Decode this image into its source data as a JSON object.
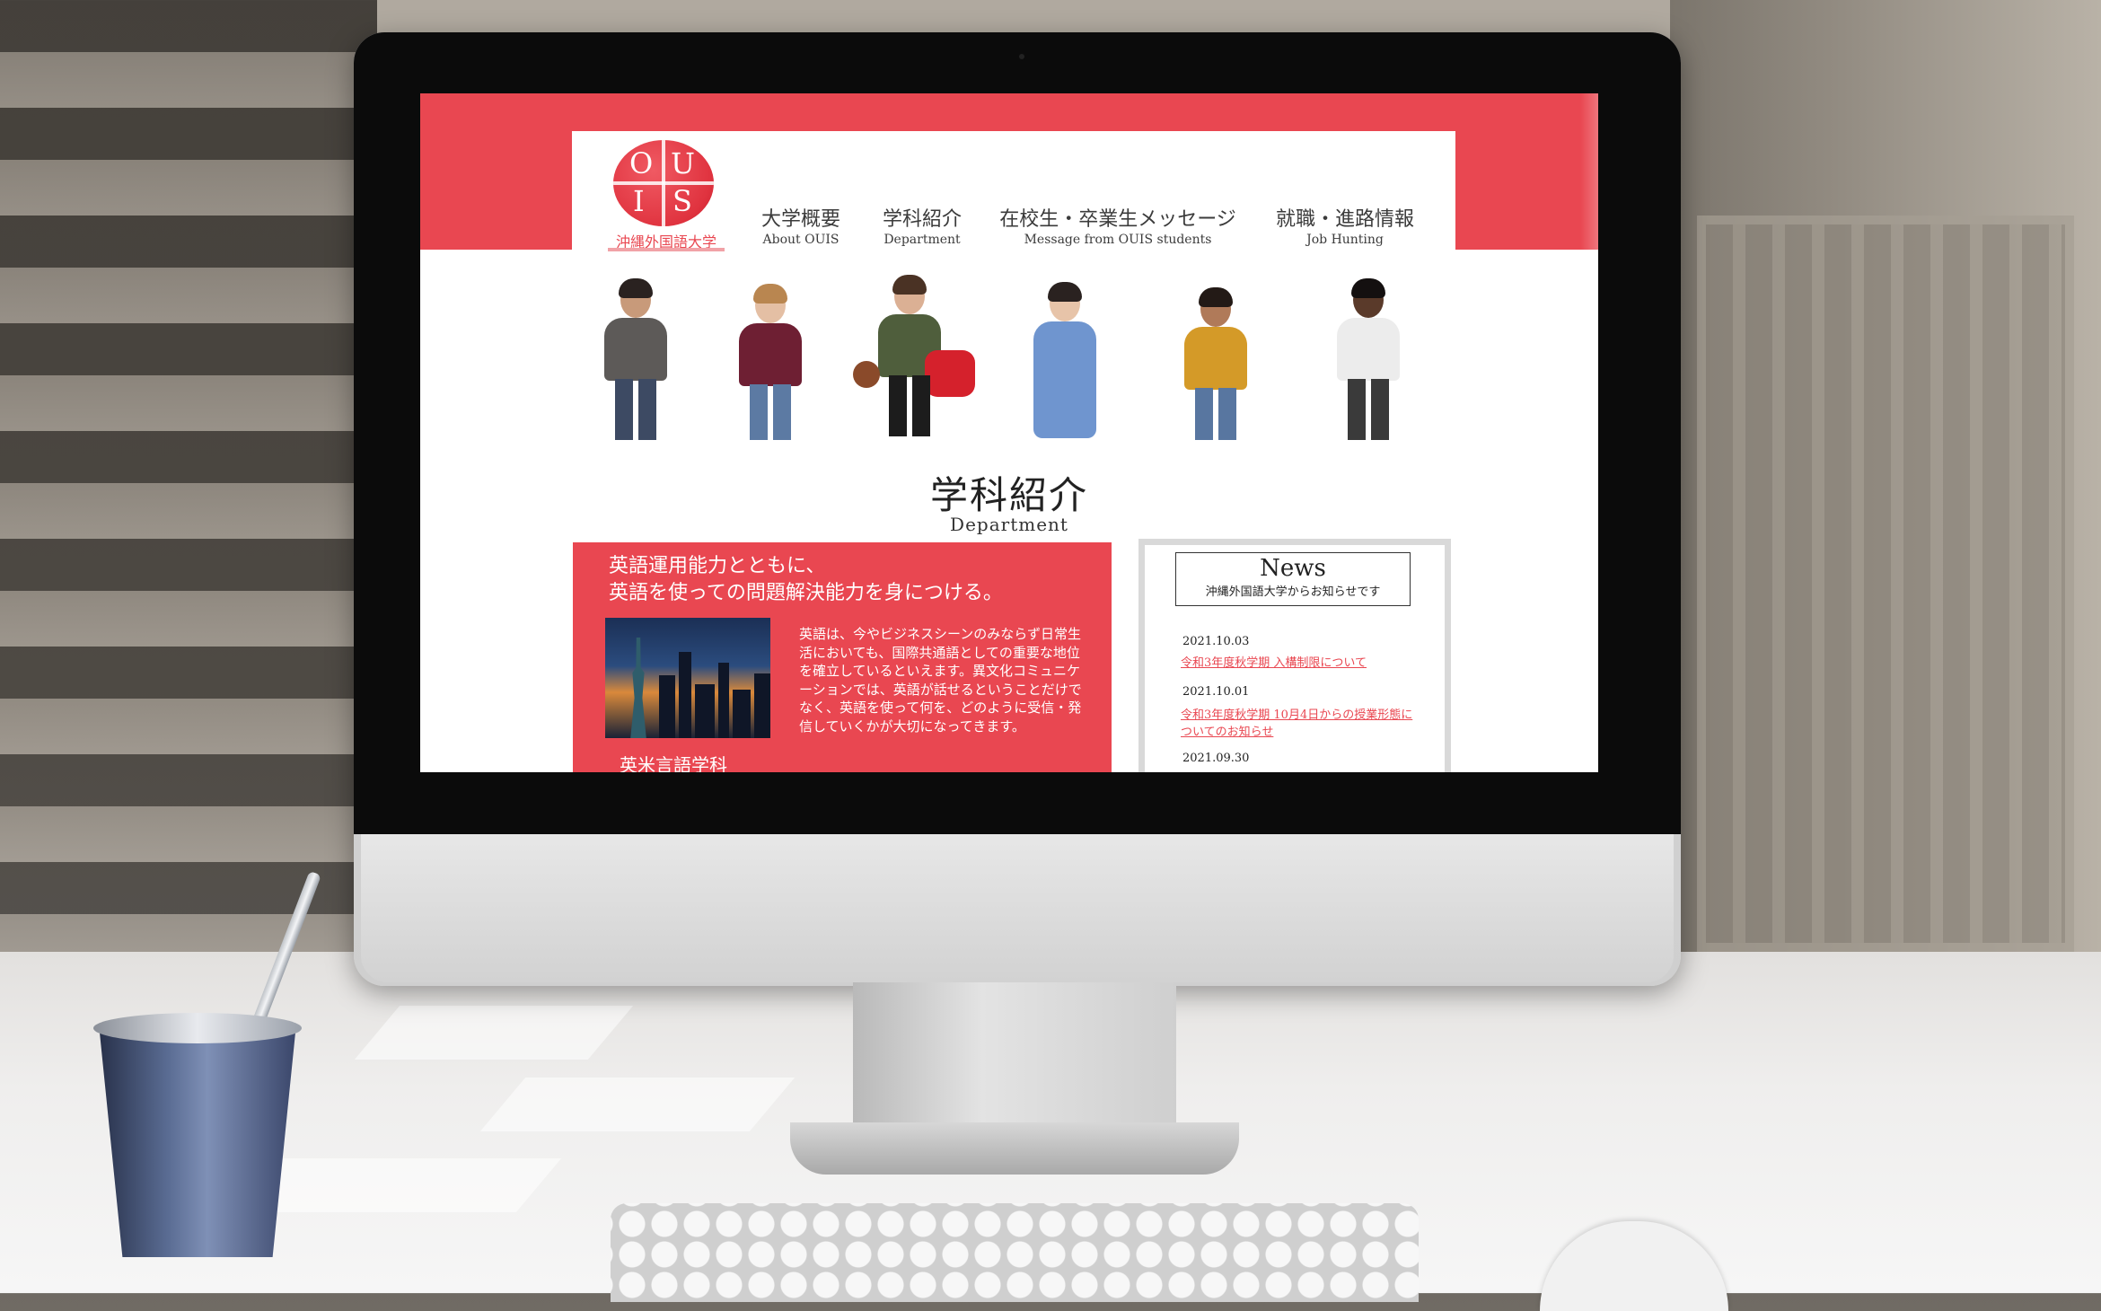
{
  "site": {
    "logo": {
      "letters": [
        "O",
        "U",
        "I",
        "S"
      ],
      "caption": "沖縄外国語大学"
    },
    "nav": [
      {
        "jp": "大学概要",
        "en": "About OUIS"
      },
      {
        "jp": "学科紹介",
        "en": "Department"
      },
      {
        "jp": "在校生・卒業生メッセージ",
        "en": "Message from OUIS students"
      },
      {
        "jp": "就職・進路情報",
        "en": "Job Hunting"
      }
    ]
  },
  "section": {
    "title": "学科紹介",
    "subtitle": "Department"
  },
  "department": {
    "headline_line1": "英語運用能力とともに、",
    "headline_line2": "英語を使っての問題解決能力を身につける。",
    "body": "英語は、今やビジネスシーンのみならず日常生活においても、国際共通語としての重要な地位を確立しているといえます。異文化コミュニケーションでは、英語が話せるということだけでなく、英語を使って何を、どのように受信・発信していくかが大切になってきます。",
    "name": "英米言語学科"
  },
  "news": {
    "title": "News",
    "description": "沖縄外国語大学からお知らせです",
    "items": [
      {
        "date": "2021.10.03",
        "text": "令和3年度秋学期 入構制限について"
      },
      {
        "date": "2021.10.01",
        "text": "令和3年度秋学期 10月4日からの授業形態についてのお知らせ"
      },
      {
        "date": "2021.09.30",
        "text": ""
      }
    ]
  },
  "colors": {
    "brand_red": "#e94751",
    "text_dark": "#3b3b3b",
    "news_frame": "#d9d9d9"
  }
}
